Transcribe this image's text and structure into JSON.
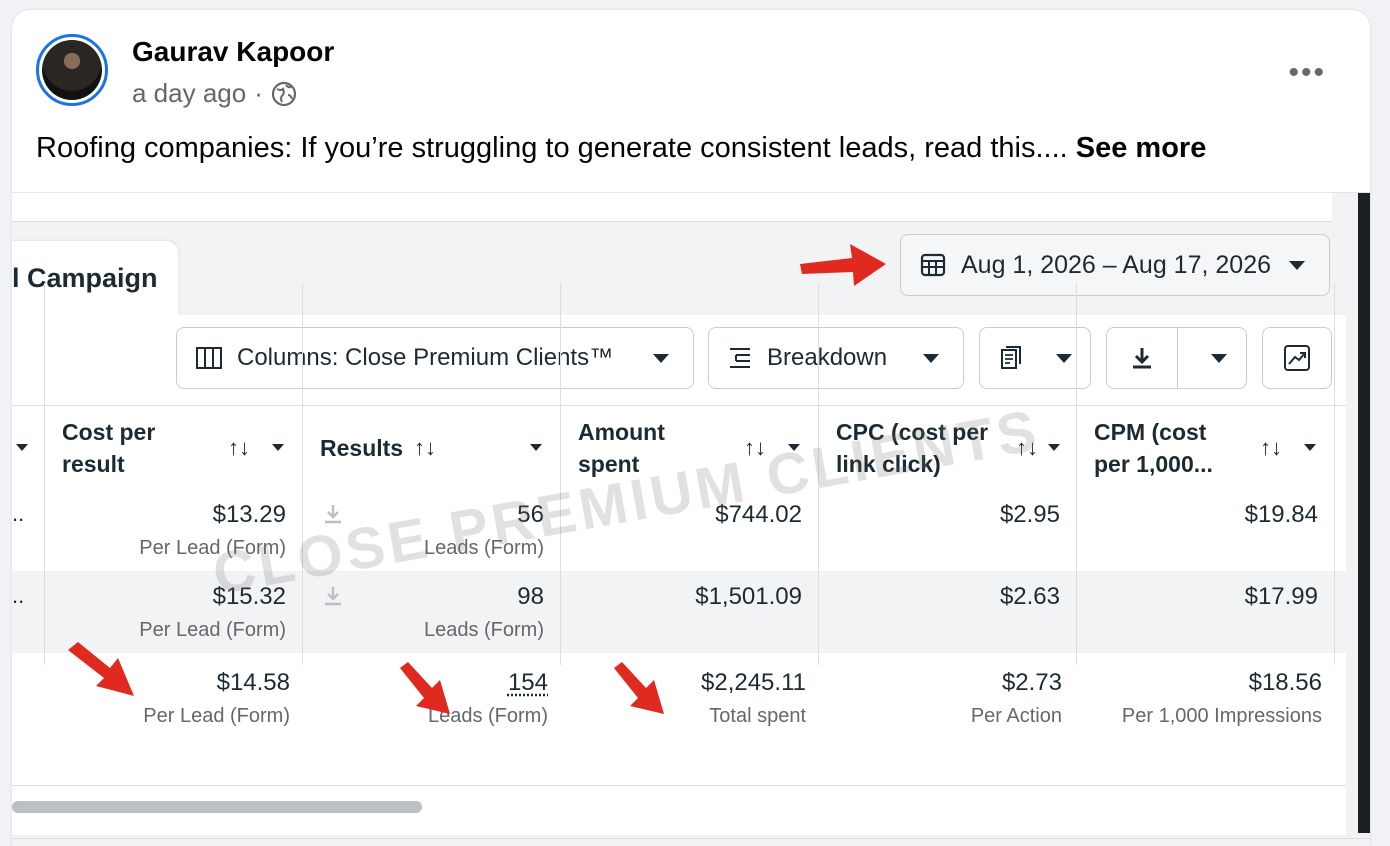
{
  "post": {
    "author": "Gaurav Kapoor",
    "time": "a day ago",
    "separator": "·",
    "text": "Roofing companies: If you’re struggling to generate consistent leads, read this.... ",
    "see_more": "See more",
    "more_label": "•••"
  },
  "screenshot": {
    "tab_label": "l Campaign",
    "date_range": "Aug 1, 2026 – Aug 17, 2026",
    "toolbar": {
      "columns": "Columns: Close Premium Clients™",
      "breakdown": "Breakdown"
    },
    "headers": {
      "cost_per_result_1": "Cost per",
      "cost_per_result_2": "result",
      "results": "Results",
      "amount_spent_1": "Amount",
      "amount_spent_2": "spent",
      "cpc_1": "CPC (cost per",
      "cpc_2": "link click)",
      "cpm_1": "CPM (cost",
      "cpm_2": "per 1,000..."
    },
    "sort_glyph": "↑↓",
    "ellipsis": "..",
    "rows": [
      {
        "cost": "$13.29",
        "cost_sub": "Per Lead (Form)",
        "results": "56",
        "results_sub": "Leads (Form)",
        "spent": "$744.02",
        "cpc": "$2.95",
        "cpm": "$19.84"
      },
      {
        "cost": "$15.32",
        "cost_sub": "Per Lead (Form)",
        "results": "98",
        "results_sub": "Leads (Form)",
        "spent": "$1,501.09",
        "cpc": "$2.63",
        "cpm": "$17.99"
      }
    ],
    "total": {
      "cost": "$14.58",
      "cost_sub": "Per Lead (Form)",
      "results": "154",
      "results_sub": "Leads (Form)",
      "spent": "$2,245.11",
      "spent_sub": "Total spent",
      "cpc": "$2.73",
      "cpc_sub": "Per Action",
      "cpm": "$18.56",
      "cpm_sub": "Per 1,000 Impressions"
    },
    "watermark": "CLOSE PREMIUM CLIENTS",
    "colors": {
      "arrow": "#e02a1f",
      "accent": "#1b74e4"
    }
  }
}
